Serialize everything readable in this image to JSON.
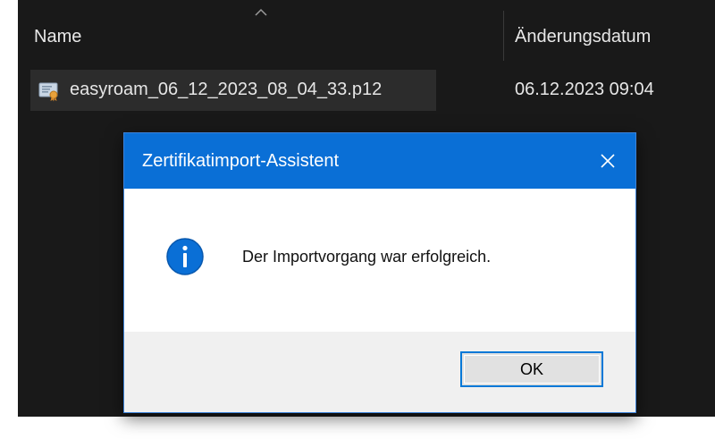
{
  "explorer": {
    "columns": {
      "name": "Name",
      "modified": "Änderungsdatum",
      "sort_icon": "chevron-up-icon"
    },
    "file": {
      "name": "easyroam_06_12_2023_08_04_33.p12",
      "modified": "06.12.2023 09:04",
      "icon": "certificate-file-icon"
    }
  },
  "dialog": {
    "title": "Zertifikatimport-Assistent",
    "close_icon": "close-icon",
    "icon": "info-icon",
    "message": "Der Importvorgang war erfolgreich.",
    "ok_label": "OK"
  },
  "colors": {
    "title_bar": "#0a6fd6",
    "explorer_background": "#191919",
    "info_icon": "#0a6fd6",
    "button_border": "#0078d7"
  }
}
